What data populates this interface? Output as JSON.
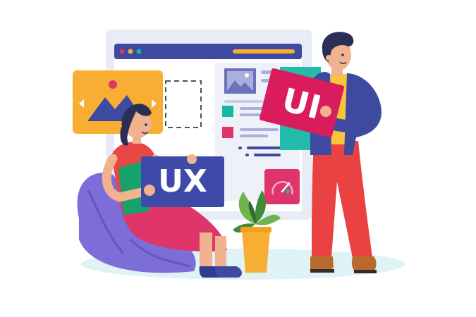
{
  "illustration": {
    "signs": {
      "ux_label": "UX",
      "ui_label": "UI"
    },
    "icons": {
      "image_card": "image-icon",
      "thumbnail": "image-icon",
      "browser_dots": "window-dots-icon",
      "gauge": "gauge-icon",
      "plant": "potted-plant-icon"
    },
    "colors": {
      "ux_sign": "#3f4aa8",
      "ui_sign": "#d91c5c",
      "browser_bg": "#e7ecf7",
      "browser_bar": "#3d4aa0",
      "image_card": "#f8ae32",
      "accent_teal": "#18b7a5",
      "accent_pink": "#e0356b",
      "beanbag": "#7c6dd8",
      "floor": "#dff2f5"
    }
  }
}
